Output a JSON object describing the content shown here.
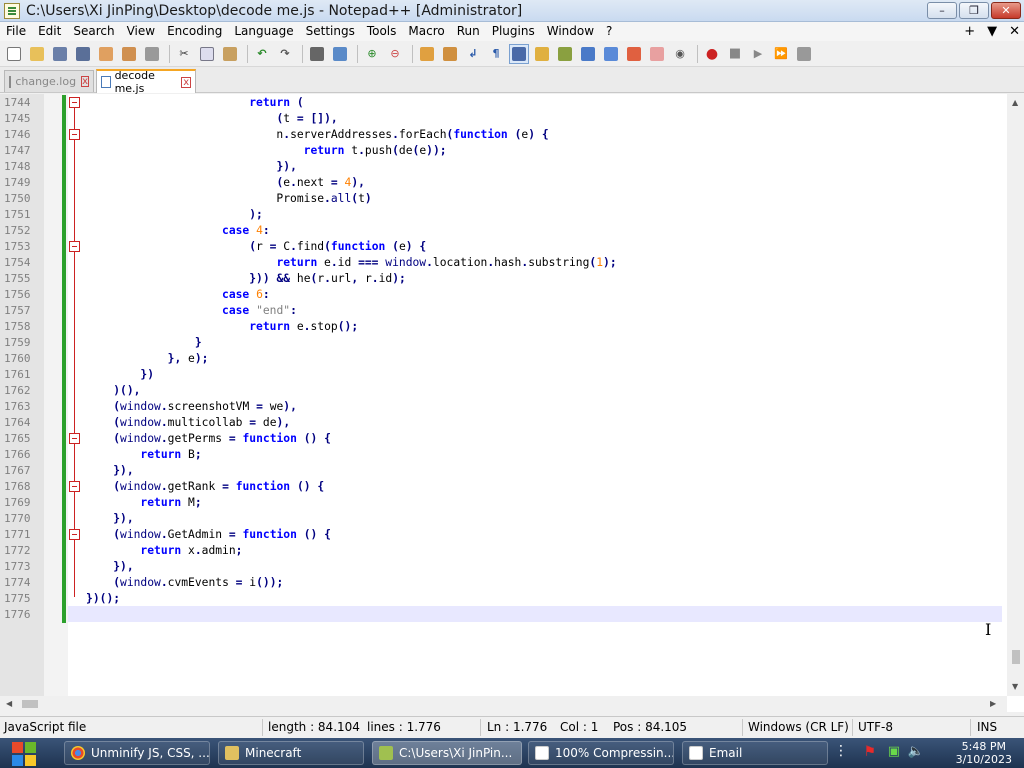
{
  "window": {
    "title": "C:\\Users\\Xi JinPing\\Desktop\\decode me.js - Notepad++ [Administrator]",
    "min": "–",
    "max": "❐",
    "close": "✕"
  },
  "menu": {
    "items": [
      "File",
      "Edit",
      "Search",
      "View",
      "Encoding",
      "Language",
      "Settings",
      "Tools",
      "Macro",
      "Run",
      "Plugins",
      "Window",
      "?"
    ],
    "right": [
      "+",
      "▼",
      "✕"
    ]
  },
  "tabs": [
    {
      "label": "change.log",
      "active": false
    },
    {
      "label": "decode me.js",
      "active": true
    }
  ],
  "editor": {
    "first_line": 1744,
    "line_numbers": [
      "1744",
      "1745",
      "1746",
      "1747",
      "1748",
      "1749",
      "1750",
      "1751",
      "1752",
      "1753",
      "1754",
      "1755",
      "1756",
      "1757",
      "1758",
      "1759",
      "1760",
      "1761",
      "1762",
      "1763",
      "1764",
      "1765",
      "1766",
      "1767",
      "1768",
      "1769",
      "1770",
      "1771",
      "1772",
      "1773",
      "1774",
      "1775",
      "1776"
    ],
    "code": [
      "                        return (",
      "                            (t = []),",
      "                            n.serverAddresses.forEach(function (e) {",
      "                                return t.push(de(e));",
      "                            }),",
      "                            (e.next = 4),",
      "                            Promise.all(t)",
      "                        );",
      "                    case 4:",
      "                        (r = C.find(function (e) {",
      "                            return e.id === window.location.hash.substring(1);",
      "                        })) && he(r.url, r.id);",
      "                    case 6:",
      "                    case \"end\":",
      "                        return e.stop();",
      "                }",
      "            }, e);",
      "        })",
      "    )(),",
      "    (window.screenshotVM = we),",
      "    (window.multicollab = de),",
      "    (window.getPerms = function () {",
      "        return B;",
      "    }),",
      "    (window.getRank = function () {",
      "        return M;",
      "    }),",
      "    (window.GetAdmin = function () {",
      "        return x.admin;",
      "    }),",
      "    (window.cvmEvents = i());",
      "})();",
      ""
    ],
    "fold_lines": [
      0,
      2,
      9,
      21,
      24,
      27
    ],
    "colors": {
      "keyword": "#0000ff",
      "operator": "#000080",
      "number": "#ff8000",
      "string": "#808080",
      "change_bar": "#2ca02c"
    }
  },
  "status": {
    "file_type": "JavaScript file",
    "length": "length : 84.104",
    "lines": "lines : 1.776",
    "ln": "Ln : 1.776",
    "col": "Col : 1",
    "pos": "Pos : 84.105",
    "eol": "Windows (CR LF)",
    "encoding": "UTF-8",
    "mode": "INS"
  },
  "taskbar": {
    "tasks": [
      {
        "label": "Unminify JS, CSS, ...",
        "icon": "chrome-icon",
        "color": "#e8b020"
      },
      {
        "label": "Minecraft",
        "icon": "folder-icon",
        "color": "#e0c060"
      },
      {
        "label": "C:\\Users\\Xi JinPin...",
        "icon": "notepadpp-icon",
        "color": "#a0c050"
      },
      {
        "label": "100% Compressin...",
        "icon": "app-icon",
        "color": "#ffffff"
      },
      {
        "label": "Email",
        "icon": "app-icon",
        "color": "#ffffff"
      }
    ],
    "time": "5:48 PM",
    "date": "3/10/2023"
  }
}
